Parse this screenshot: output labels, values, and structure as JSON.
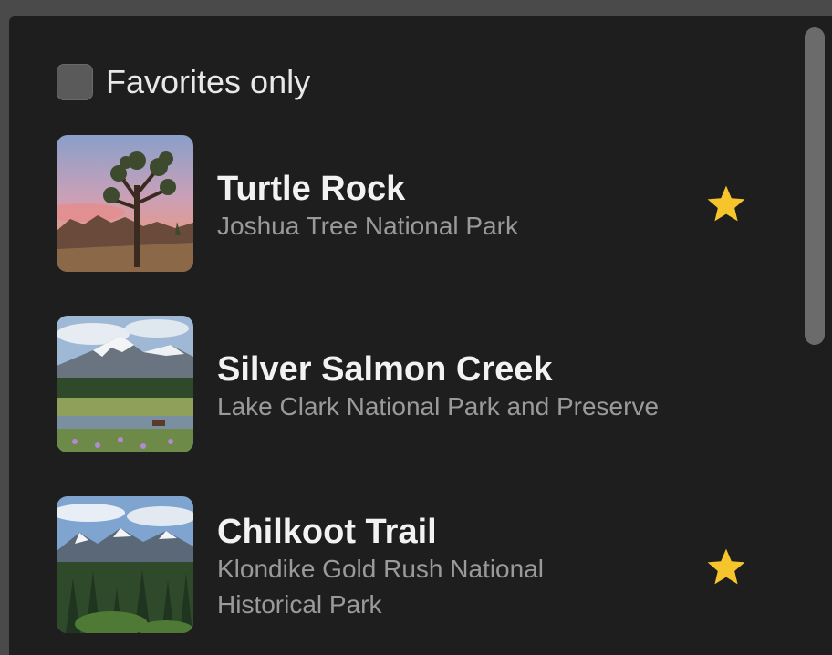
{
  "filter": {
    "label": "Favorites only",
    "checked": false
  },
  "landmarks": [
    {
      "name": "Turtle Rock",
      "park": "Joshua Tree National Park",
      "favorite": true,
      "image_icon": "joshua-tree-photo"
    },
    {
      "name": "Silver Salmon Creek",
      "park": "Lake Clark National Park and Preserve",
      "favorite": false,
      "image_icon": "mountain-meadow-photo"
    },
    {
      "name": "Chilkoot Trail",
      "park": "Klondike Gold Rush National Historical Park",
      "favorite": true,
      "image_icon": "alpine-forest-photo"
    }
  ],
  "colors": {
    "accent_star": "#f6c52c",
    "background": "#1e1e1e"
  }
}
